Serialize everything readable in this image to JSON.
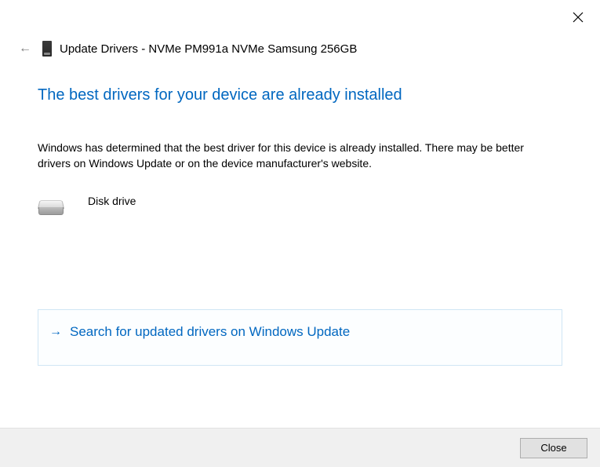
{
  "window": {
    "title": "Update Drivers - NVMe PM991a NVMe Samsung 256GB"
  },
  "content": {
    "heading": "The best drivers for your device are already installed",
    "description": "Windows has determined that the best driver for this device is already installed. There may be better drivers on Windows Update or on the device manufacturer's website.",
    "device_name": "Disk drive",
    "search_link": "Search for updated drivers on Windows Update"
  },
  "footer": {
    "close_label": "Close"
  },
  "icons": {
    "back": "←",
    "link_arrow": "→"
  }
}
